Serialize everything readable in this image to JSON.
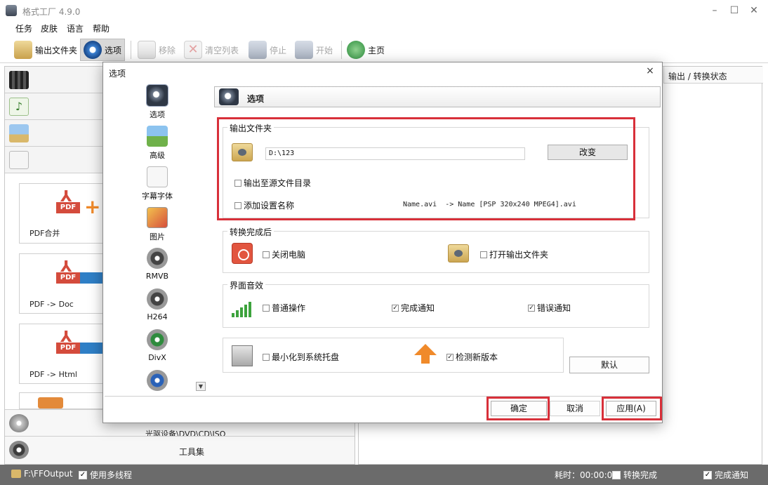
{
  "window": {
    "title": "格式工厂 4.9.0",
    "minimize": "–",
    "maximize": "☐",
    "close": "✕"
  },
  "menu": [
    "任务",
    "皮肤",
    "语言",
    "帮助"
  ],
  "toolbar": {
    "output_folder": "输出文件夹",
    "options": "选项",
    "remove": "移除",
    "clear_list": "清空列表",
    "stop": "停止",
    "start": "开始",
    "home": "主页"
  },
  "left_panel": {
    "tiles": [
      "PDF合并",
      "PDF -> Doc",
      "PDF -> Html"
    ],
    "pdf_badge": "PDF",
    "bottom_items": [
      "光驱设备\\DVD\\CD\\ISO",
      "工具集"
    ]
  },
  "right_panel": {
    "column_header": "输出 / 转换状态"
  },
  "dialog": {
    "title": "选项",
    "close": "×",
    "header": "选项",
    "nav": [
      "选项",
      "高级",
      "字幕字体",
      "图片",
      "RMVB",
      "H264",
      "DivX"
    ],
    "output_group": {
      "title": "输出文件夹",
      "path": "D:\\123",
      "change_button": "改变",
      "to_source_dir": "输出至源文件目录",
      "add_setting_name": "添加设置名称",
      "name_example": "Name.avi  -> Name [PSP 320x240 MPEG4].avi"
    },
    "after_group": {
      "title": "转换完成后",
      "shutdown": "关闭电脑",
      "open_output": "打开输出文件夹"
    },
    "sound_group": {
      "title": "界面音效",
      "normal_op": "普通操作",
      "complete_notify": "完成通知",
      "error_notify": "错误通知"
    },
    "misc": {
      "minimize_tray": "最小化到系统托盘",
      "check_update": "检测新版本"
    },
    "default_button": "默认",
    "ok_button": "确定",
    "cancel_button": "取消",
    "apply_button": "应用(A)"
  },
  "statusbar": {
    "output_path": "F:\\FFOutput",
    "multithread": "使用多线程",
    "elapsed": "耗时：00:00:00",
    "after_convert": "转换完成",
    "notify": "完成通知"
  },
  "checked": "✓",
  "scroll_down": "▼",
  "colors": {
    "highlight": "#d8303a",
    "statusbar": "#6b6b6b",
    "pdf_red": "#d44b3c",
    "arrow_blue": "#2f7fc6"
  }
}
